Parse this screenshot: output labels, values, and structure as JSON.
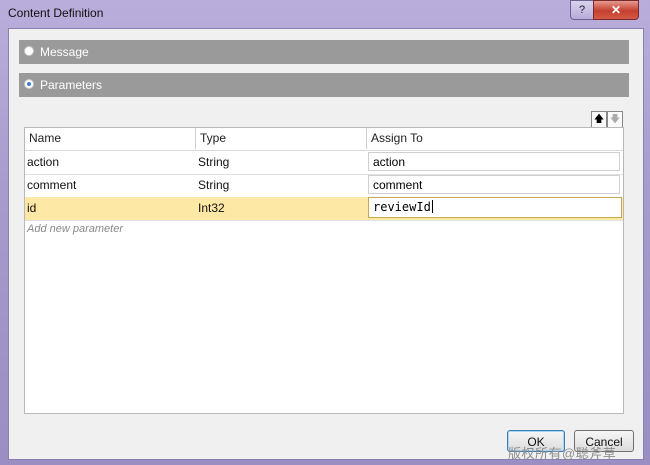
{
  "window": {
    "title": "Content Definition",
    "help_label": "?",
    "close_label": "✕"
  },
  "options": [
    {
      "label": "Message",
      "selected": false
    },
    {
      "label": "Parameters",
      "selected": true
    }
  ],
  "toolbar": {
    "move_up": "🡅",
    "move_down": "🡇"
  },
  "grid": {
    "columns": [
      "Name",
      "Type",
      "Assign To"
    ],
    "rows": [
      {
        "name": "action",
        "type": "String",
        "assign": "action"
      },
      {
        "name": "comment",
        "type": "String",
        "assign": "comment"
      },
      {
        "name": "id",
        "type": "Int32",
        "assign": "reviewId"
      }
    ],
    "add_new": "Add new parameter"
  },
  "buttons": {
    "ok": "OK",
    "cancel": "Cancel"
  },
  "watermark": "版权所有@聪斧草"
}
